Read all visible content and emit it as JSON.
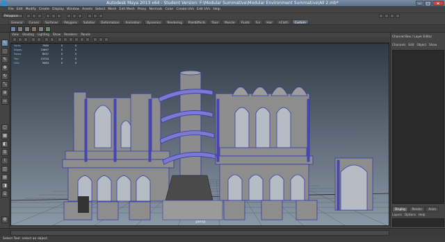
{
  "window": {
    "title": "Autodesk Maya 2013 x64 - Student Version: F:\\Modular Summative\\Modular Environment Summative\\All 2.mb*",
    "minimize": "–",
    "maximize": "□",
    "close": "✕"
  },
  "menu": [
    "File",
    "Edit",
    "Modify",
    "Create",
    "Display",
    "Window",
    "Assets",
    "Select",
    "Mesh",
    "Edit Mesh",
    "Proxy",
    "Normals",
    "Color",
    "Create UVs",
    "Edit UVs",
    "Help"
  ],
  "mode_select": "Polygons",
  "shelf_tabs": [
    "General",
    "Curves",
    "Surfaces",
    "Polygons",
    "Subdivs",
    "Deformation",
    "Animation",
    "Dynamics",
    "Rendering",
    "PaintEffects",
    "Toon",
    "Muscle",
    "Fluids",
    "Fur",
    "Hair",
    "nCloth",
    "Custom"
  ],
  "shelf_active": "Custom",
  "panel_menu": [
    "View",
    "Shading",
    "Lighting",
    "Show",
    "Renderer",
    "Panels"
  ],
  "hud": {
    "rows": [
      {
        "label": "Verts:",
        "values": [
          "7960",
          "0",
          "0"
        ]
      },
      {
        "label": "Edges:",
        "values": [
          "15697",
          "0",
          "0"
        ]
      },
      {
        "label": "Faces:",
        "values": [
          "8037",
          "0",
          "0"
        ]
      },
      {
        "label": "Tris:",
        "values": [
          "15724",
          "0",
          "0"
        ]
      },
      {
        "label": "UVs:",
        "values": [
          "9083",
          "0",
          "0"
        ]
      }
    ]
  },
  "viewport_label": "persp",
  "right_panel": {
    "title": "Channel Box / Layer Editor",
    "menu": [
      "Channels",
      "Edit",
      "Object",
      "Show"
    ],
    "tabs": [
      "Display",
      "Render",
      "Anim"
    ],
    "active_tab": "Display",
    "submenu": [
      "Layers",
      "Options",
      "Help"
    ]
  },
  "status": "Select Tool: select an object",
  "colors": {
    "viewport_top": "#2f3a47",
    "viewport_bottom": "#8c99a6",
    "wire": "#3a3aa8",
    "mesh": "#8c8c8c",
    "accent": "#5f6a78"
  }
}
